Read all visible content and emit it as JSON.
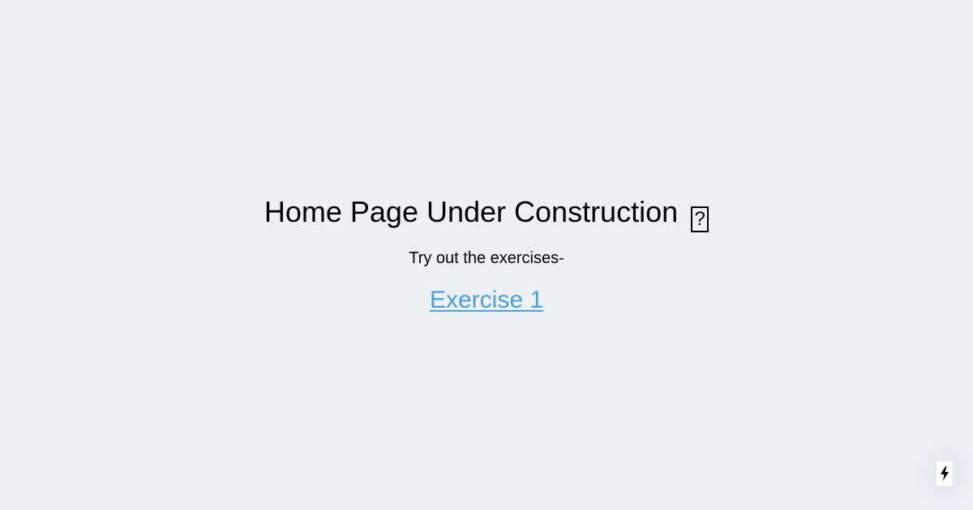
{
  "main": {
    "title": "Home Page Under Construction",
    "title_icon_glyph": "?",
    "subtitle": "Try out the exercises-",
    "links": [
      {
        "label": "Exercise 1"
      }
    ]
  },
  "colors": {
    "background": "#edf1f6",
    "link": "#4a9fdc",
    "text": "#000000"
  },
  "icons": {
    "title_icon": "construction-emoji-icon",
    "dev_indicator": "lightning-bolt-icon"
  }
}
